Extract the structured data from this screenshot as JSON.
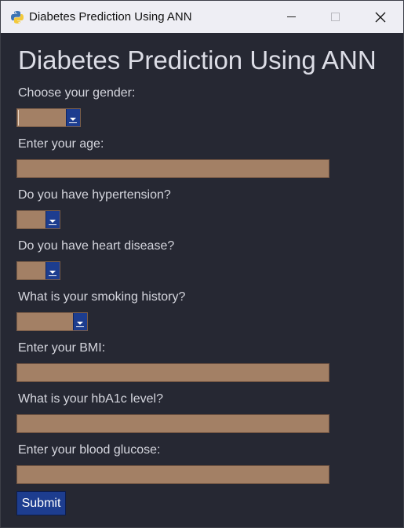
{
  "window": {
    "title": "Diabetes Prediction Using ANN"
  },
  "form": {
    "heading": "Diabetes Prediction Using ANN",
    "gender_label": "Choose your gender:",
    "gender_value": "",
    "age_label": "Enter your age:",
    "age_value": "",
    "hypertension_label": "Do you have hypertension?",
    "hypertension_value": "",
    "heart_disease_label": "Do you have heart disease?",
    "heart_disease_value": "",
    "smoking_label": "What is your smoking history?",
    "smoking_value": "",
    "bmi_label": "Enter your BMI:",
    "bmi_value": "",
    "hba1c_label": "What is your hbA1c level?",
    "hba1c_value": "",
    "glucose_label": "Enter your blood glucose:",
    "glucose_value": "",
    "submit_label": "Submit"
  },
  "colors": {
    "background": "#262833",
    "field": "#a38065",
    "accent": "#1d3d8f",
    "text": "#d5d6de"
  },
  "icons": {
    "app": "python-icon",
    "minimize": "minimize-icon",
    "maximize": "maximize-icon",
    "close": "close-icon",
    "dropdown": "chevron-down-icon"
  }
}
